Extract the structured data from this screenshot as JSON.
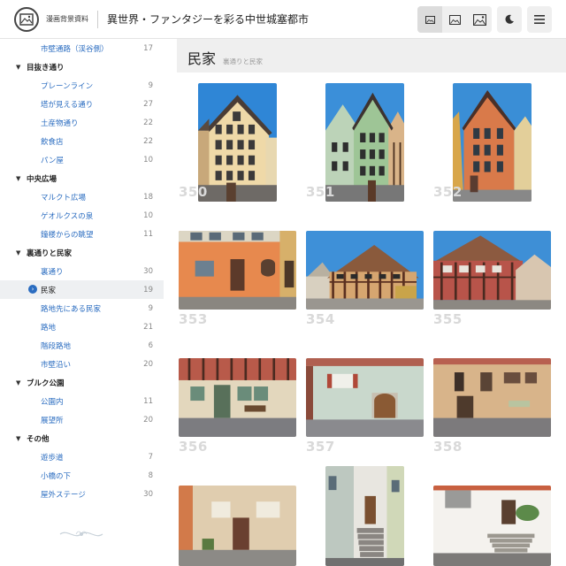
{
  "header": {
    "site_name": "漫画背景資料",
    "page_heading": "異世界・ファンタジーを彩る中世城塞都市",
    "buttons": [
      "small-grid-icon",
      "medium-grid-icon",
      "large-grid-icon",
      "moon-icon",
      "menu-icon"
    ]
  },
  "sidebar": {
    "items": [
      {
        "type": "child",
        "label": "市壁通路（渓谷側）",
        "count": "17"
      },
      {
        "type": "category",
        "label": "目抜き通り"
      },
      {
        "type": "child",
        "label": "プレーンライン",
        "count": "9"
      },
      {
        "type": "child",
        "label": "塔が見える通り",
        "count": "27"
      },
      {
        "type": "child",
        "label": "土産物通り",
        "count": "22"
      },
      {
        "type": "child",
        "label": "飲食店",
        "count": "22"
      },
      {
        "type": "child",
        "label": "パン屋",
        "count": "10"
      },
      {
        "type": "category",
        "label": "中央広場"
      },
      {
        "type": "child",
        "label": "マルクト広場",
        "count": "18"
      },
      {
        "type": "child",
        "label": "ゲオルクスの泉",
        "count": "10"
      },
      {
        "type": "child",
        "label": "鐘楼からの眺望",
        "count": "11"
      },
      {
        "type": "category",
        "label": "裏通りと民家"
      },
      {
        "type": "child",
        "label": "裏通り",
        "count": "30"
      },
      {
        "type": "child",
        "label": "民家",
        "count": "19",
        "selected": true
      },
      {
        "type": "child",
        "label": "路地先にある民家",
        "count": "9"
      },
      {
        "type": "child",
        "label": "路地",
        "count": "21"
      },
      {
        "type": "child",
        "label": "階段路地",
        "count": "6"
      },
      {
        "type": "child",
        "label": "市壁沿い",
        "count": "20"
      },
      {
        "type": "category",
        "label": "ブルク公園"
      },
      {
        "type": "child",
        "label": "公園内",
        "count": "11"
      },
      {
        "type": "child",
        "label": "展望所",
        "count": "20"
      },
      {
        "type": "category",
        "label": "その他"
      },
      {
        "type": "child",
        "label": "遊歩道",
        "count": "7"
      },
      {
        "type": "child",
        "label": "小橋の下",
        "count": "8"
      },
      {
        "type": "child",
        "label": "屋外ステージ",
        "count": "30"
      }
    ]
  },
  "main": {
    "title": "民家",
    "subtitle": "裏通りと民家",
    "photos": [
      {
        "number": "350",
        "scene": "tall-gabled-cream-house"
      },
      {
        "number": "351",
        "scene": "green-gabled-house"
      },
      {
        "number": "352",
        "scene": "orange-gabled-house"
      },
      {
        "number": "353",
        "scene": "orange-facade-street"
      },
      {
        "number": "354",
        "scene": "half-timbered-house"
      },
      {
        "number": "355",
        "scene": "red-half-timbered-house"
      },
      {
        "number": "356",
        "scene": "timbered-ground-floor"
      },
      {
        "number": "357",
        "scene": "green-wall-arched-door"
      },
      {
        "number": "358",
        "scene": "brick-house-with-shutters"
      },
      {
        "number": "",
        "scene": "orange-house-doorway"
      },
      {
        "number": "",
        "scene": "stairway-alley"
      },
      {
        "number": "",
        "scene": "white-house-courtyard"
      }
    ]
  }
}
